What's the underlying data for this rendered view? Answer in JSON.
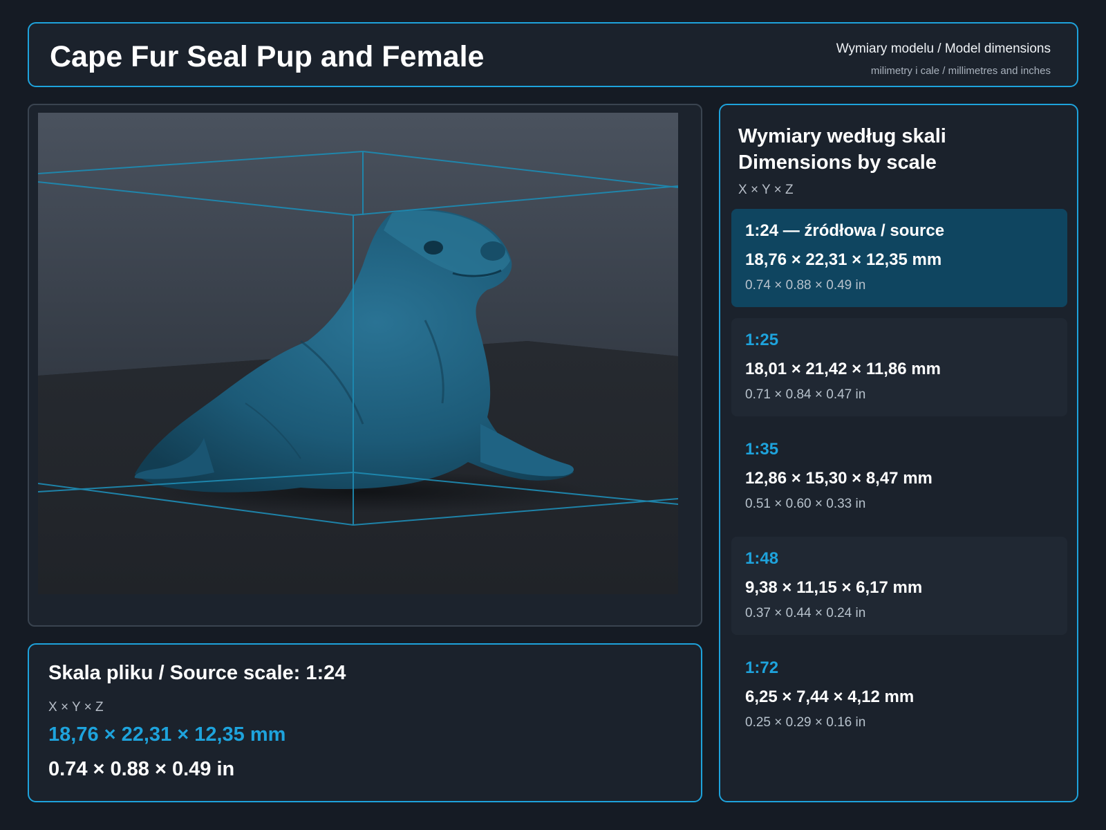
{
  "header": {
    "title": "Cape Fur Seal Pup and Female",
    "subtitle": "Wymiary modelu / Model dimensions",
    "units_note": "milimetry i cale / millimetres and inches"
  },
  "source": {
    "title": "Skala pliku / Source scale: 1:24",
    "axes": "X × Y × Z",
    "mm": "18,76 × 22,31 × 12,35 mm",
    "inches": "0.74 × 0.88 × 0.49 in"
  },
  "sidebar": {
    "title_line1": "Wymiary według skali",
    "title_line2": "Dimensions by scale",
    "axes": "X × Y × Z",
    "scales": [
      {
        "label": "1:24  —  źródłowa / source",
        "mm": "18,76 × 22,31 × 12,35 mm",
        "inches": "0.74 × 0.88 × 0.49 in"
      },
      {
        "label": "1:25",
        "mm": "18,01 × 21,42 × 11,86 mm",
        "inches": "0.71 × 0.84 × 0.47 in"
      },
      {
        "label": "1:35",
        "mm": "12,86 × 15,30 × 8,47 mm",
        "inches": "0.51 × 0.60 × 0.33 in"
      },
      {
        "label": "1:48",
        "mm": "9,38 × 11,15 × 6,17 mm",
        "inches": "0.37 × 0.44 × 0.24 in"
      },
      {
        "label": "1:72",
        "mm": "6,25 × 7,44 × 4,12 mm",
        "inches": "0.25 × 0.29 × 0.16 in"
      }
    ]
  },
  "colors": {
    "accent": "#1ea3dc",
    "model": "#1d5c7a",
    "active_card": "#0f4560"
  }
}
